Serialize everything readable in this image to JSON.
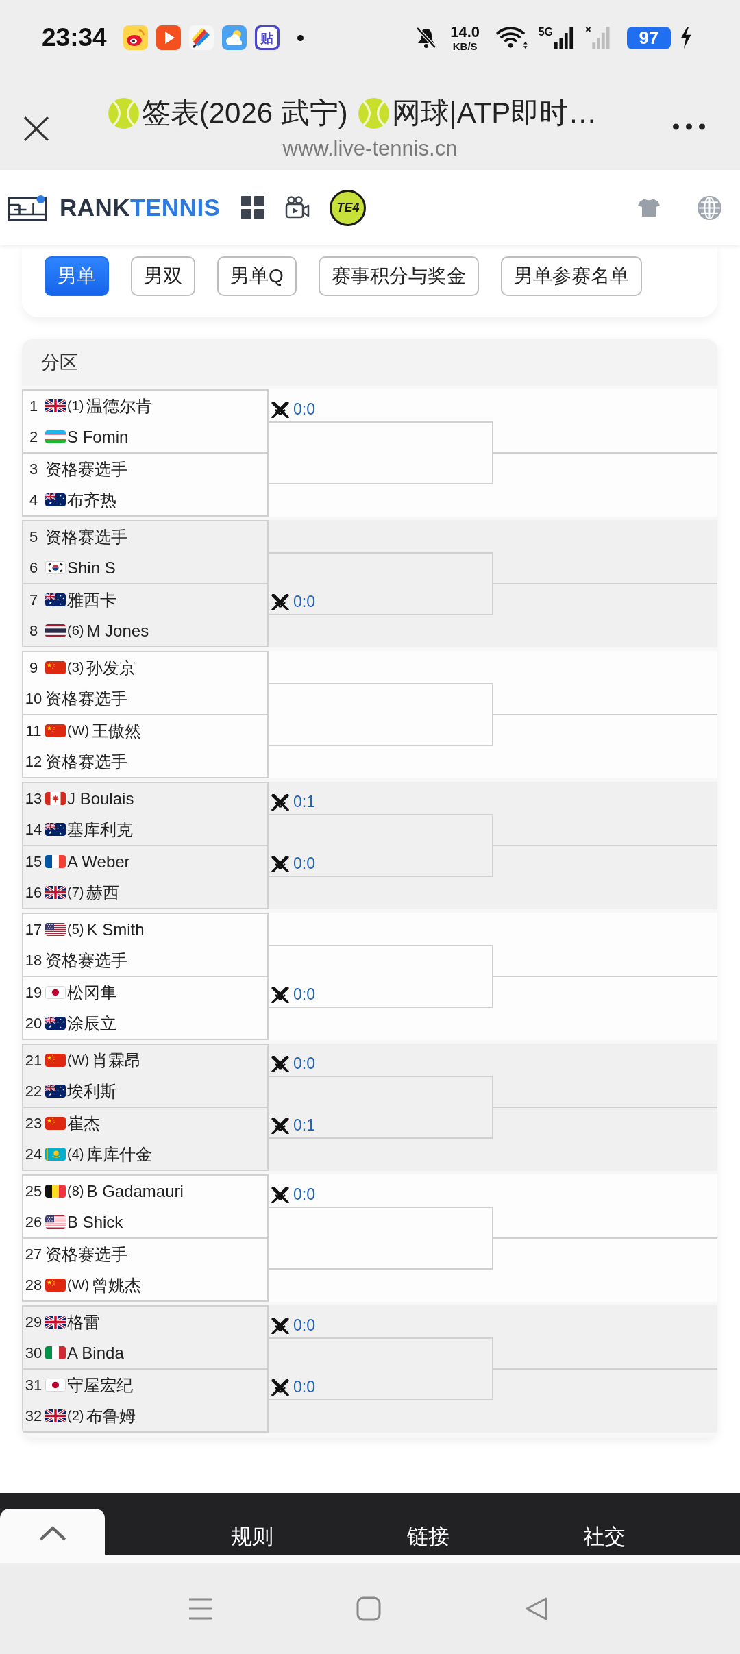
{
  "status_bar": {
    "time": "23:34",
    "app_badge": "贴",
    "silent": true,
    "speed": "14.0",
    "speed_unit": "KB/S",
    "network": "5G",
    "battery": "97",
    "charging": true
  },
  "browser": {
    "title_parts": [
      {
        "kind": "ball"
      },
      {
        "kind": "text",
        "text": "签表(2026 武宁)"
      },
      {
        "kind": "ball"
      },
      {
        "kind": "text",
        "text": "网球|ATP即时…"
      }
    ],
    "url": "www.live-tennis.cn"
  },
  "site_header": {
    "logo_dark": "RANK",
    "logo_blue": "TENNIS",
    "badge": "TE4"
  },
  "tabs": [
    {
      "label": "男单",
      "selected": true
    },
    {
      "label": "男双",
      "selected": false
    },
    {
      "label": "男单Q",
      "selected": false
    },
    {
      "label": "赛事积分与奖金",
      "selected": false
    },
    {
      "label": "男单参赛名单",
      "selected": false
    }
  ],
  "draw": {
    "title": "分区",
    "sections": [
      {
        "matches": [
          {
            "score": "0:0",
            "players": [
              {
                "number": "1",
                "kind": "britain",
                "seed": "(1)",
                "name": "温德尔肯"
              },
              {
                "number": "2",
                "kind": "uzbekistan",
                "name": "S Fomin"
              }
            ]
          },
          {
            "players": [
              {
                "number": "3",
                "name": "资格赛选手"
              },
              {
                "number": "4",
                "kind": "australia",
                "name": "布齐热"
              }
            ]
          }
        ]
      },
      {
        "matches": [
          {
            "players": [
              {
                "number": "5",
                "name": "资格赛选手"
              },
              {
                "number": "6",
                "kind": "korea",
                "name": "Shin S"
              }
            ]
          },
          {
            "score": "0:0",
            "players": [
              {
                "number": "7",
                "kind": "australia",
                "name": "雅西卡"
              },
              {
                "number": "8",
                "kind": "thailand",
                "seed": "(6)",
                "name": "M Jones"
              }
            ]
          }
        ]
      },
      {
        "matches": [
          {
            "players": [
              {
                "number": "9",
                "kind": "china",
                "seed": "(3)",
                "name": "孙发京"
              },
              {
                "number": "10",
                "name": "资格赛选手"
              }
            ]
          },
          {
            "players": [
              {
                "number": "11",
                "kind": "china",
                "seed": "(W)",
                "name": "王傲然"
              },
              {
                "number": "12",
                "name": "资格赛选手"
              }
            ]
          }
        ]
      },
      {
        "matches": [
          {
            "score": "0:1",
            "players": [
              {
                "number": "13",
                "kind": "canada",
                "name": "J Boulais"
              },
              {
                "number": "14",
                "kind": "australia",
                "name": "塞库利克"
              }
            ]
          },
          {
            "score": "0:0",
            "players": [
              {
                "number": "15",
                "kind": "france",
                "name": "A Weber"
              },
              {
                "number": "16",
                "kind": "britain",
                "seed": "(7)",
                "name": "赫西"
              }
            ]
          }
        ]
      },
      {
        "matches": [
          {
            "players": [
              {
                "number": "17",
                "kind": "usa",
                "seed": "(5)",
                "name": "K Smith"
              },
              {
                "number": "18",
                "name": "资格赛选手"
              }
            ]
          },
          {
            "score": "0:0",
            "players": [
              {
                "number": "19",
                "kind": "japan",
                "name": "松冈隼"
              },
              {
                "number": "20",
                "kind": "australia",
                "name": "涂辰立"
              }
            ]
          }
        ]
      },
      {
        "matches": [
          {
            "score": "0:0",
            "players": [
              {
                "number": "21",
                "kind": "china",
                "seed": "(W)",
                "name": "肖霖昂"
              },
              {
                "number": "22",
                "kind": "australia",
                "name": "埃利斯"
              }
            ]
          },
          {
            "score": "0:1",
            "players": [
              {
                "number": "23",
                "kind": "china",
                "name": "崔杰"
              },
              {
                "number": "24",
                "kind": "kazakhstan",
                "seed": "(4)",
                "name": "库库什金"
              }
            ]
          }
        ]
      },
      {
        "matches": [
          {
            "score": "0:0",
            "players": [
              {
                "number": "25",
                "kind": "belgium",
                "seed": "(8)",
                "name": "B Gadamauri"
              },
              {
                "number": "26",
                "kind": "usa",
                "name": "B Shick"
              }
            ]
          },
          {
            "players": [
              {
                "number": "27",
                "name": "资格赛选手"
              },
              {
                "number": "28",
                "kind": "china",
                "seed": "(W)",
                "name": "曾姚杰"
              }
            ]
          }
        ]
      },
      {
        "matches": [
          {
            "score": "0:0",
            "players": [
              {
                "number": "29",
                "kind": "britain",
                "name": "格雷"
              },
              {
                "number": "30",
                "kind": "italy",
                "name": "A Binda"
              }
            ]
          },
          {
            "score": "0:0",
            "players": [
              {
                "number": "31",
                "kind": "japan",
                "name": "守屋宏纪"
              },
              {
                "number": "32",
                "kind": "britain",
                "seed": "(2)",
                "name": "布鲁姆"
              }
            ]
          }
        ]
      }
    ]
  },
  "footer": {
    "links": [
      "规则",
      "链接",
      "社交"
    ]
  }
}
